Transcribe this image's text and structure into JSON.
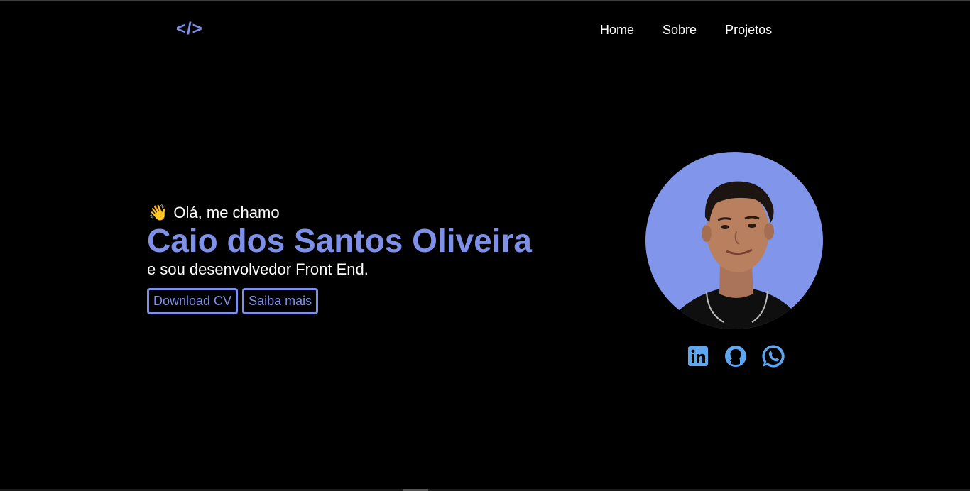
{
  "header": {
    "logo_text": "</>",
    "nav": [
      {
        "label": "Home"
      },
      {
        "label": "Sobre"
      },
      {
        "label": "Projetos"
      }
    ]
  },
  "hero": {
    "wave_emoji": "👋",
    "greeting": "Olá, me chamo",
    "name": "Caio dos Santos Oliveira",
    "tagline": "e sou desenvolvedor Front End.",
    "buttons": {
      "download_label": "Download CV",
      "more_label": "Saiba mais"
    }
  },
  "profile": {
    "socials": [
      {
        "icon": "linkedin-icon"
      },
      {
        "icon": "github-icon"
      },
      {
        "icon": "whatsapp-icon"
      }
    ]
  },
  "colors": {
    "background": "#000000",
    "accent": "#7e90e8",
    "avatar_bg": "#8196ea",
    "social_icon": "#5fa6f0"
  }
}
